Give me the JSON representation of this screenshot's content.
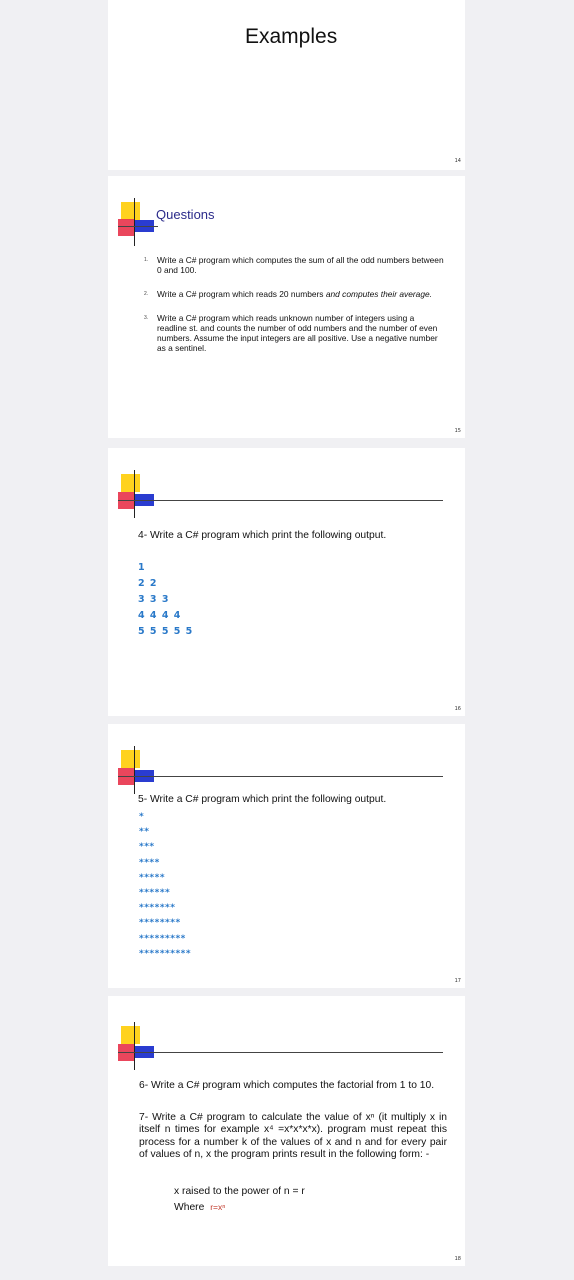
{
  "slides": [
    {
      "title": "Examples",
      "page": "14"
    },
    {
      "title": "Questions",
      "page": "15",
      "items": [
        {
          "num": "1.",
          "text": "Write a C# program which computes the sum of all the odd numbers between 0 and 100."
        },
        {
          "num": "2.",
          "text": "Write a C# program which reads 20 numbers",
          "text_italic": "and computes their average."
        },
        {
          "num": "3.",
          "text": "Write a C# program which reads unknown number of integers using a readline st. and counts the number of odd numbers and the number of even numbers. Assume the input integers are all positive. Use a negative number as a sentinel."
        }
      ]
    },
    {
      "heading": "4- Write a C# program which print the following output.",
      "page": "16",
      "output": [
        "1",
        "2 2",
        "3 3 3",
        "4 4 4 4",
        "5 5 5 5 5"
      ]
    },
    {
      "heading": "5- Write a C# program which print the following output.",
      "page": "17",
      "output": [
        "*",
        "**",
        "***",
        "****",
        "*****",
        "******",
        "*******",
        "********",
        "*********",
        "**********"
      ]
    },
    {
      "page": "18",
      "q6": "6- Write a C# program which computes the factorial from 1 to 10.",
      "q7": "7- Write a C# program to calculate the value of xⁿ (it multiply x in itself n times for example x⁴ =x*x*x*x). program must repeat this process for a number k of the values of x and n and for every pair of values of n, x the program prints result in the following form: -",
      "line1": "x raised to the power of n = r",
      "line2_label": "Where",
      "line2_formula": "r=xⁿ"
    }
  ]
}
